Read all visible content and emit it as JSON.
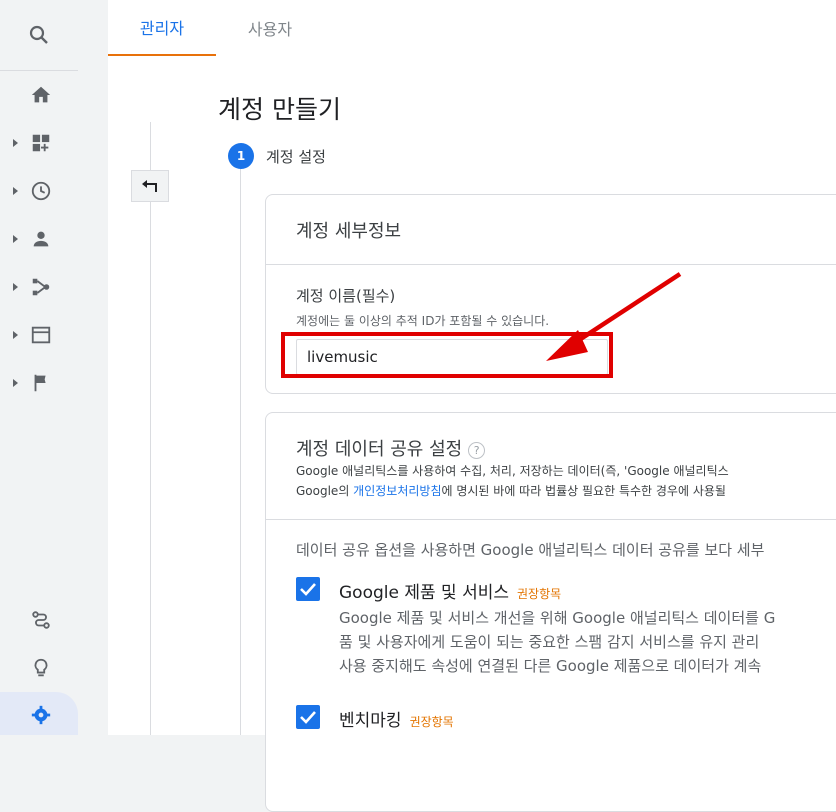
{
  "tabs": {
    "admin": "관리자",
    "user": "사용자"
  },
  "page": {
    "title": "계정 만들기",
    "step_number": "1",
    "step_label": "계정 설정"
  },
  "account_details": {
    "title": "계정 세부정보",
    "field_label": "계정 이름(필수)",
    "field_help": "계정에는 둘 이상의 추적 ID가 포함될 수 있습니다.",
    "field_value": "livemusic"
  },
  "data_sharing": {
    "title": "계정 데이터 공유 설정",
    "help_glyph": "?",
    "desc_line1": "Google 애널리틱스를 사용하여 수집, 처리, 저장하는 데이터(즉, 'Google 애널리틱스",
    "desc_line2_prefix": "Google의 ",
    "desc_line2_link": "개인정보처리방침",
    "desc_line2_suffix": "에 명시된 바에 따라 법률상 필요한 특수한 경우에 사용될",
    "intro": "데이터 공유 옵션을 사용하면 Google 애널리틱스 데이터 공유를 보다 세부",
    "options": [
      {
        "title": "Google 제품 및 서비스",
        "badge": "권장항목",
        "checked": true,
        "desc": [
          "Google 제품 및 서비스 개선을 위해 Google 애널리틱스 데이터를 G",
          "품 및 사용자에게 도움이 되는 중요한 스팸 감지 서비스를 유지 관리",
          "사용 중지해도 속성에 연결된 다른 Google 제품으로 데이터가 계속"
        ]
      },
      {
        "title": "벤치마킹",
        "badge": "권장항목",
        "checked": true
      }
    ]
  },
  "colors": {
    "accent": "#1a73e8",
    "tab_underline": "#e8710a",
    "annotation_red": "#e00000",
    "badge": "#e37400"
  }
}
